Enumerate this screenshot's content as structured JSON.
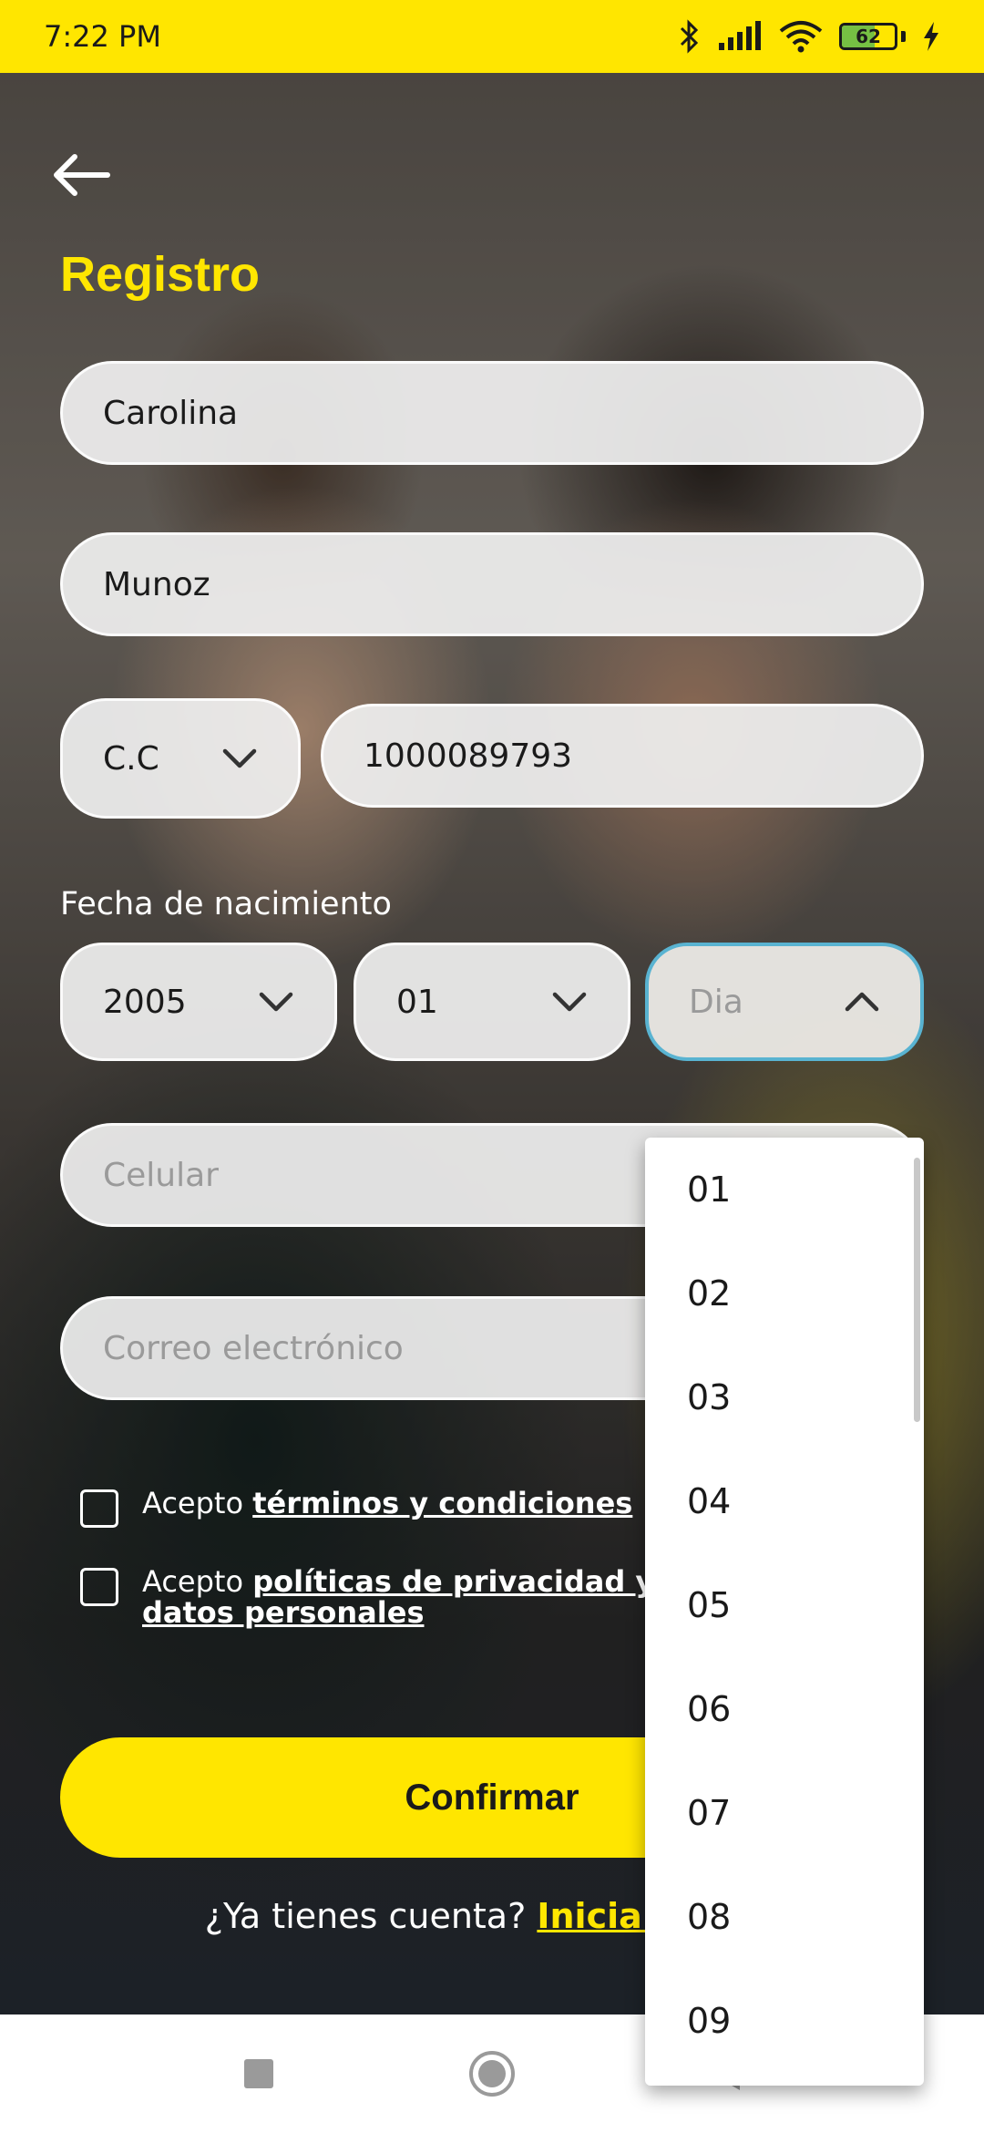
{
  "status_bar": {
    "time": "7:22 PM",
    "battery_percent": "62",
    "battery_level": 0.62,
    "icons": [
      "bluetooth-icon",
      "signal-icon",
      "wifi-icon",
      "battery-icon",
      "charging-icon"
    ]
  },
  "header": {
    "title": "Registro"
  },
  "form": {
    "first_name_value": "Carolina",
    "last_name_value": "Munoz",
    "doc_type_value": "C.C",
    "doc_number_value": "1000089793",
    "birth_label": "Fecha de nacimiento",
    "birth_year_value": "2005",
    "birth_month_value": "01",
    "birth_day_placeholder": "Dia",
    "phone_placeholder": "Celular",
    "email_placeholder": "Correo electrónico"
  },
  "checks": {
    "terms_prefix": "Acepto",
    "terms_link": "términos y condiciones",
    "privacy_prefix": "Acepto",
    "privacy_link": "políticas de privacidad y tratamiento de datos personales"
  },
  "actions": {
    "confirm_label": "Confirmar",
    "login_prompt": "¿Ya tienes cuenta?",
    "login_link": "Inicia sesión"
  },
  "day_dropdown": {
    "options": [
      "01",
      "02",
      "03",
      "04",
      "05",
      "06",
      "07",
      "08",
      "09"
    ]
  },
  "colors": {
    "brand_yellow": "#ffe600",
    "focus_border": "#59b3d1"
  }
}
